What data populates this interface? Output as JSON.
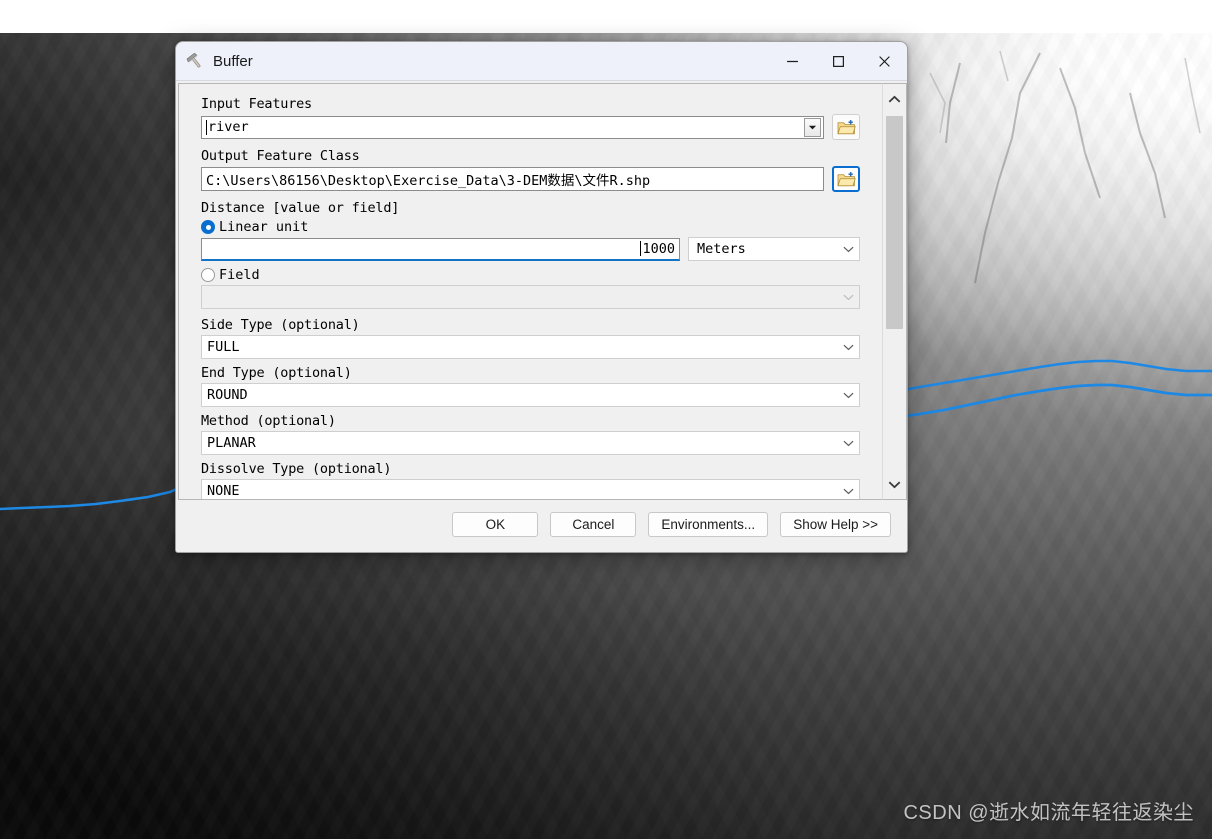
{
  "dialog": {
    "title": "Buffer",
    "icon": "hammer-tool-icon",
    "window_controls": {
      "minimize": "—",
      "maximize": "☐",
      "close": "✕"
    },
    "fields": {
      "input_features": {
        "label": "Input Features",
        "value": "river",
        "browse": "folder-browse-icon"
      },
      "output_feature_class": {
        "label": "Output Feature Class",
        "value": "C:\\Users\\86156\\Desktop\\Exercise_Data\\3-DEM数据\\文件R.shp",
        "browse": "folder-browse-icon"
      },
      "distance": {
        "label": "Distance [value or field]",
        "linear_unit_label": "Linear unit",
        "linear_unit_selected": true,
        "linear_value": "1000",
        "unit": "Meters",
        "field_label": "Field",
        "field_value": "",
        "field_selected": false
      },
      "side_type": {
        "label": "Side Type (optional)",
        "value": "FULL"
      },
      "end_type": {
        "label": "End Type (optional)",
        "value": "ROUND"
      },
      "method": {
        "label": "Method (optional)",
        "value": "PLANAR"
      },
      "dissolve_type": {
        "label": "Dissolve Type (optional)",
        "value": "NONE"
      }
    },
    "scrollbar": {
      "up": "chevron-up-icon",
      "down": "chevron-down-icon"
    },
    "buttons": {
      "ok": "OK",
      "cancel": "Cancel",
      "environments": "Environments...",
      "show_help": "Show Help >>"
    }
  },
  "map": {
    "layer_type": "DEM grayscale raster",
    "river_color": "#1E88E5",
    "watermark": "CSDN @逝水如流年轻往返染尘"
  }
}
